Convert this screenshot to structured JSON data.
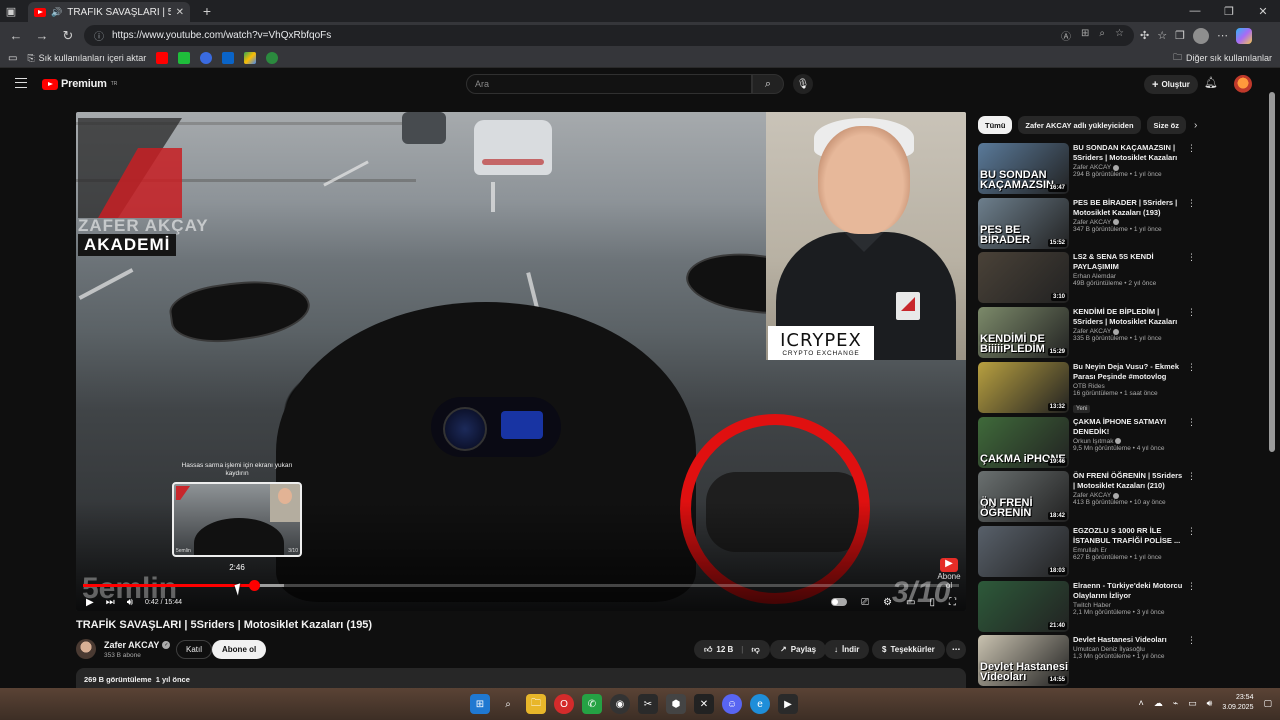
{
  "browser": {
    "tab_title": "TRAFİK SAVAŞLARI | 5Sriders",
    "url": "https://www.youtube.com/watch?v=VhQxRbfqoFs",
    "bookmarks_import": "Sık kullanılanları içeri aktar",
    "other_favorites": "Diğer sık kullanılanlar"
  },
  "yt": {
    "logo_text": "Premium",
    "logo_region": "TR",
    "search_placeholder": "Ara",
    "create_label": "Oluştur"
  },
  "player": {
    "watermark_name": "ZAFER AKÇAY",
    "watermark_akademi": "AKADEMİ",
    "sponsor_big": "ICRYPEX",
    "sponsor_small": "CRYPTO EXCHANGE",
    "tooltip_text": "Hassas sarma işlemi için ekranı yukarı kaydırın",
    "preview_time": "2:46",
    "preview_label_left": "5emlin",
    "preview_label_right": "3/10",
    "subtitle_left": "5emlin",
    "subtitle_right": "3/10",
    "abone_label": "Abone ol",
    "time_current": "0:42",
    "time_total": "15:44",
    "progress_played": 0.195,
    "progress_buffered": 0.23
  },
  "video": {
    "title": "TRAFİK SAVAŞLARI | 5Sriders | Motosiklet Kazaları (195)",
    "channel": "Zafer AKCAY",
    "subscribers": "353 B abone",
    "join_label": "Katıl",
    "subscribe_label": "Abone ol",
    "likes": "12 B",
    "share_label": "Paylaş",
    "download_label": "İndir",
    "thanks_label": "Teşekkürler",
    "views_line": "269 B görüntüleme",
    "date_line": "1 yıl önce"
  },
  "sidebar": {
    "chips": [
      "Tümü",
      "Zafer AKCAY adlı yükleyiciden",
      "Size öz"
    ],
    "items": [
      {
        "title": "BU SONDAN KAÇAMAZSIN | 5Sriders | Motosiklet Kazaları ...",
        "channel": "Zafer AKCAY",
        "verified": true,
        "views": "294 B görüntüleme • 1 yıl önce",
        "duration": "16:47",
        "caption": "BU SONDAN KAÇAMAZSIN",
        "bg": "#5a7a9a"
      },
      {
        "title": "PES BE BİRADER | 5Sriders | Motosiklet Kazaları (193)",
        "channel": "Zafer AKCAY",
        "verified": true,
        "views": "347 B görüntüleme • 1 yıl önce",
        "duration": "15:52",
        "caption": "PES BE BİRADER",
        "bg": "#6d7f8d"
      },
      {
        "title": "LS2 & SENA 5S KENDİ PAYLAŞIMIM",
        "channel": "Erhan Alemdar",
        "verified": false,
        "views": "49B görüntüleme • 2 yıl önce",
        "duration": "3:10",
        "caption": "",
        "bg": "#4a4238"
      },
      {
        "title": "KENDİMİ DE BİPLEDİM | 5Sriders | Motosiklet Kazaları ...",
        "channel": "Zafer AKCAY",
        "verified": true,
        "views": "335 B görüntüleme • 1 yıl önce",
        "duration": "15:29",
        "caption": "KENDİMİ DE BiiiiiPLEDİM",
        "bg": "#7c8a6a"
      },
      {
        "title": "Bu Neyin Deja Vusu? - Ekmek Parası Peşinde #motovlog",
        "channel": "OTB Rides",
        "verified": false,
        "views": "16 görüntüleme • 1 saat önce",
        "duration": "13:32",
        "caption": "",
        "new": "Yeni",
        "bg": "#b8a040"
      },
      {
        "title": "ÇAKMA İPHONE SATMAYI DENEDİK!",
        "channel": "Orkun Işıtmak",
        "verified": true,
        "views": "9,5 Mn görüntüleme • 4 yıl önce",
        "duration": "19:46",
        "caption": "ÇAKMA iPHONE",
        "bg": "#3f6a3a"
      },
      {
        "title": "ÖN FRENİ ÖĞRENİN | 5Sriders | Motosiklet Kazaları (210)",
        "channel": "Zafer AKCAY",
        "verified": true,
        "views": "413 B görüntüleme • 10 ay önce",
        "duration": "18:42",
        "caption": "ÖN FRENİ ÖĞRENİN",
        "bg": "#6a7070"
      },
      {
        "title": "EGZOZLU S 1000 RR İLE İSTANBUL TRAFİĞİ POLİSE ...",
        "channel": "Emrullah Er",
        "verified": false,
        "views": "627 B görüntüleme • 1 yıl önce",
        "duration": "18:03",
        "caption": "",
        "bg": "#58606a"
      },
      {
        "title": "Elraenn - Türkiye'deki Motorcu Olaylarını İzliyor",
        "channel": "Twitch Haber",
        "verified": false,
        "views": "2,1 Mn görüntüleme • 3 yıl önce",
        "duration": "21:40",
        "caption": "",
        "bg": "#2d5a3a"
      },
      {
        "title": "Devlet Hastanesi Videoları",
        "channel": "Umutcan Deniz İlyasoğlu",
        "verified": false,
        "views": "1,3 Mn görüntüleme • 1 yıl önce",
        "duration": "14:55",
        "caption": "Devlet Hastanesi Videoları",
        "bg": "#c9c2b0"
      }
    ]
  },
  "taskbar": {
    "time": "23:54",
    "date": "3.09.2025"
  },
  "colors": {
    "brand_red": "#ff0000",
    "yt_bg": "#0f0f0f",
    "annotation_red": "#e01010"
  }
}
